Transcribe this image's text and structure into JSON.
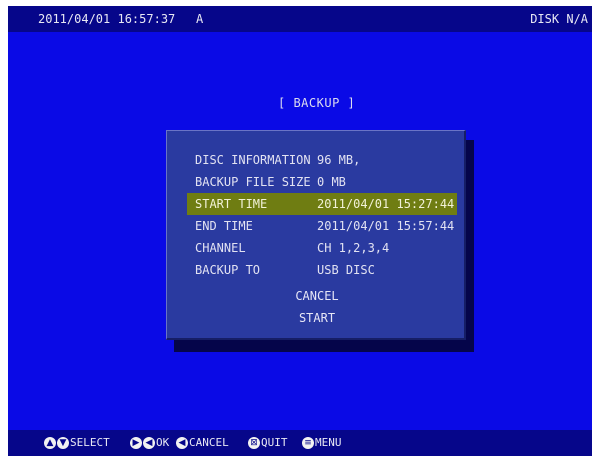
{
  "status_bar": {
    "datetime": "2011/04/01 16:57:37",
    "mode": "A",
    "disk": "DISK N/A"
  },
  "backup": {
    "title": "[ BACKUP ]",
    "rows": [
      {
        "label": "DISC INFORMATION",
        "value": "96 MB,"
      },
      {
        "label": "BACKUP FILE SIZE",
        "value": "0 MB"
      },
      {
        "label": "START TIME",
        "value": "2011/04/01 15:27:44"
      },
      {
        "label": "END TIME",
        "value": "2011/04/01 15:57:44"
      },
      {
        "label": "CHANNEL",
        "value": "CH 1,2,3,4"
      },
      {
        "label": "BACKUP TO",
        "value": "USB DISC"
      }
    ],
    "cancel_label": "CANCEL",
    "start_label": "START",
    "selected_row": "START TIME"
  },
  "footer": {
    "select": "SELECT",
    "ok": "OK",
    "cancel": "CANCEL",
    "quit": "QUIT",
    "menu": "MENU"
  },
  "icons": {
    "select": "up-down-arrows-icon",
    "ok": "left-right-arrows-icon",
    "cancel": "left-arrow-icon",
    "quit": "quit-icon",
    "menu": "menu-icon"
  },
  "colors": {
    "background": "#0a0ae6",
    "bars": "#06068a",
    "panel": "#2a3aa0",
    "selection": "#6f7d12"
  }
}
